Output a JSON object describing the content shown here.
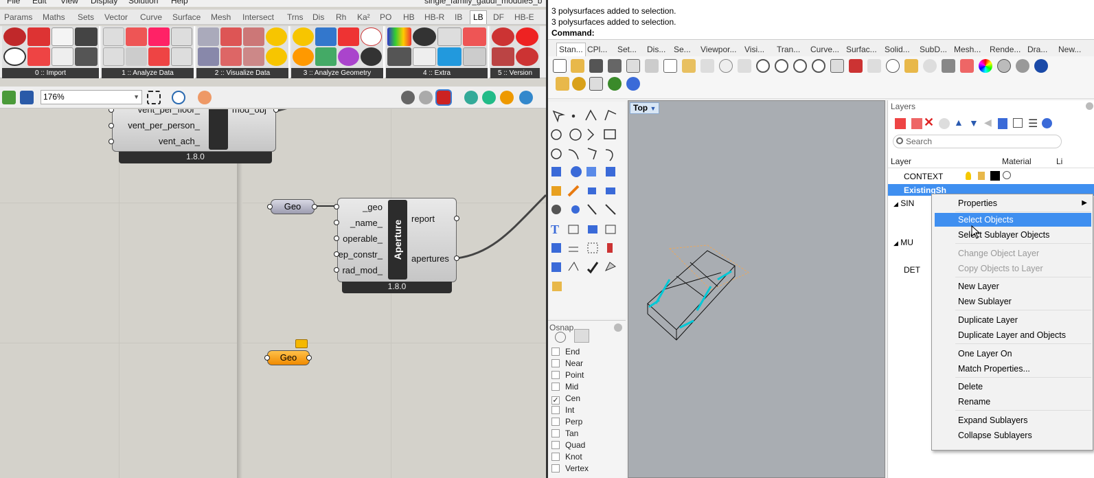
{
  "gh": {
    "menu": [
      "File",
      "Edit",
      "View",
      "Display",
      "Solution",
      "Help"
    ],
    "doc_title": "single_family_gaudi_module5_b",
    "tabs": [
      "Params",
      "Maths",
      "Sets",
      "Vector",
      "Curve",
      "Surface",
      "Mesh",
      "Intersect",
      "Trns",
      "Dis",
      "Rh",
      "Ka²",
      "PO",
      "HB",
      "HB-R",
      "IB",
      "LB",
      "DF",
      "HB-E"
    ],
    "active_tab": "LB",
    "groups": [
      "0 :: Import",
      "1 :: Analyze Data",
      "2 :: Visualize Data",
      "3 :: Analyze Geometry",
      "4 :: Extra",
      "5 :: Version"
    ],
    "zoom": "176%",
    "components": {
      "top": {
        "inputs": [
          "vent_per_floor_",
          "vent_per_person_",
          "vent_ach_"
        ],
        "output": "mod_obj",
        "version": "1.8.0"
      },
      "aperture": {
        "title": "Aperture",
        "inputs": [
          "_geo",
          "_name_",
          "operable_",
          "ep_constr_",
          "rad_mod_"
        ],
        "outputs": [
          "report",
          "apertures"
        ],
        "version": "1.8.0"
      },
      "geo1": "Geo",
      "geo2": "Geo"
    }
  },
  "rhino": {
    "history": [
      "3 polysurfaces added to selection.",
      "3 polysurfaces added to selection."
    ],
    "command_label": "Command:",
    "tabs": [
      "Stan...",
      "CPl...",
      "Set...",
      "Dis...",
      "Se...",
      "Viewpor...",
      "Visi...",
      "Tran...",
      "Curve...",
      "Surfac...",
      "Solid...",
      "SubD...",
      "Mesh...",
      "Rende...",
      "Dra...",
      "New..."
    ],
    "viewport": "Top",
    "osnap": {
      "title": "Osnap",
      "items": [
        {
          "label": "End",
          "checked": false
        },
        {
          "label": "Near",
          "checked": false
        },
        {
          "label": "Point",
          "checked": false
        },
        {
          "label": "Mid",
          "checked": false
        },
        {
          "label": "Cen",
          "checked": true
        },
        {
          "label": "Int",
          "checked": false
        },
        {
          "label": "Perp",
          "checked": false
        },
        {
          "label": "Tan",
          "checked": false
        },
        {
          "label": "Quad",
          "checked": false
        },
        {
          "label": "Knot",
          "checked": false
        },
        {
          "label": "Vertex",
          "checked": false
        }
      ]
    },
    "layers": {
      "title": "Layers",
      "search": "Search",
      "col_layer": "Layer",
      "col_material": "Material",
      "col_linetype": "Li",
      "rows": [
        "CONTEXT",
        "ExistingSh",
        "SIN",
        "MU",
        "DET"
      ]
    },
    "context_menu": {
      "items": [
        "Properties",
        "Select Objects",
        "Select Sublayer Objects",
        "Change Object Layer",
        "Copy Objects to Layer",
        "New Layer",
        "New Sublayer",
        "Duplicate Layer",
        "Duplicate Layer and Objects",
        "One Layer On",
        "Match Properties...",
        "Delete",
        "Rename",
        "Expand Sublayers",
        "Collapse Sublayers"
      ],
      "highlighted": "Select Objects"
    }
  },
  "colors": {
    "highlight": "#3f8ff0",
    "geo_orange": "#f5a623",
    "selection_cyan": "#00c8d6"
  }
}
